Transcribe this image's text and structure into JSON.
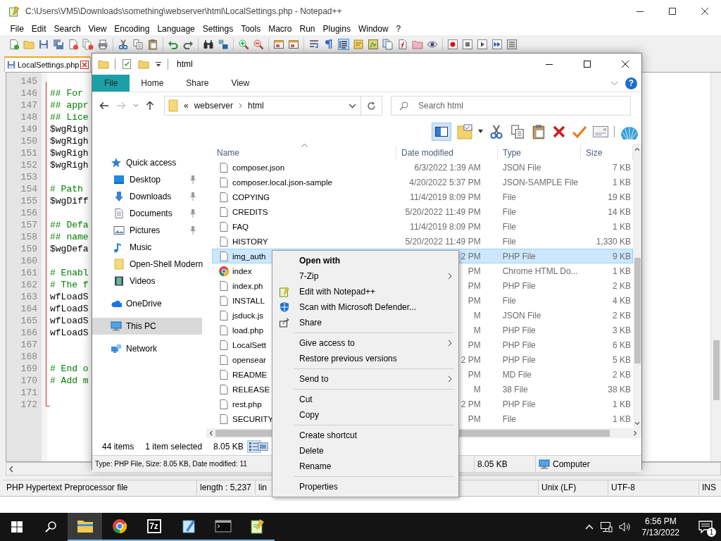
{
  "notepad": {
    "title": "C:\\Users\\VM5\\Downloads\\something\\webserver\\html\\LocalSettings.php - Notepad++",
    "menu": [
      "File",
      "Edit",
      "Search",
      "View",
      "Encoding",
      "Language",
      "Settings",
      "Tools",
      "Macro",
      "Run",
      "Plugins",
      "Window",
      "?"
    ],
    "tabs": [
      {
        "label": "LocalSettings.php",
        "selected": true
      }
    ],
    "lines": [
      {
        "number": "145"
      },
      {
        "number": "146",
        "kind": "comment",
        "text": "## For"
      },
      {
        "number": "147",
        "kind": "comment",
        "text": "## appr"
      },
      {
        "number": "148",
        "kind": "comment",
        "text": "## Lice"
      },
      {
        "number": "149",
        "kind": "code",
        "text": "$wgRigh"
      },
      {
        "number": "150",
        "kind": "code",
        "text": "$wgRigh"
      },
      {
        "number": "151",
        "kind": "code",
        "text": "$wgRigh"
      },
      {
        "number": "152",
        "kind": "code",
        "text": "$wgRigh"
      },
      {
        "number": "153"
      },
      {
        "number": "154",
        "kind": "comment",
        "text": "# Path"
      },
      {
        "number": "155",
        "kind": "code",
        "text": "$wgDiff"
      },
      {
        "number": "156"
      },
      {
        "number": "157",
        "kind": "comment",
        "text": "## Defa"
      },
      {
        "number": "158",
        "kind": "comment",
        "text": "## name"
      },
      {
        "number": "159",
        "kind": "code",
        "text": "$wgDefa"
      },
      {
        "number": "160"
      },
      {
        "number": "161",
        "kind": "comment",
        "text": "# Enabl"
      },
      {
        "number": "162",
        "kind": "comment",
        "text": "# The f"
      },
      {
        "number": "163",
        "kind": "code",
        "text": "wfLoadS"
      },
      {
        "number": "164",
        "kind": "code",
        "text": "wfLoadS"
      },
      {
        "number": "165",
        "kind": "code",
        "text": "wfLoadS"
      },
      {
        "number": "166",
        "kind": "code",
        "text": "wfLoadS"
      },
      {
        "number": "167"
      },
      {
        "number": "168"
      },
      {
        "number": "169",
        "kind": "comment",
        "text": "# End o"
      },
      {
        "number": "170",
        "kind": "comment",
        "text": "# Add m"
      },
      {
        "number": "171"
      },
      {
        "number": "172"
      }
    ],
    "status_bar": [
      "PHP Hypertext Preprocessor file",
      "length : 5,237",
      "lin",
      "Unix (LF)",
      "UTF-8",
      "INS"
    ]
  },
  "explorer": {
    "title": "html",
    "ribbon_tabs": [
      {
        "label": "File",
        "selected": true
      },
      {
        "label": "Home",
        "selected": false
      },
      {
        "label": "Share",
        "selected": false
      },
      {
        "label": "View",
        "selected": false
      }
    ],
    "help": "?",
    "address": {
      "overflow": "«",
      "crumbs": [
        "webserver",
        "html"
      ]
    },
    "search": {
      "placeholder": "Search html"
    },
    "navigation": [
      {
        "label": "Quick access",
        "selected": false,
        "children": [
          {
            "label": "Desktop",
            "selected": false,
            "pinned": true
          },
          {
            "label": "Downloads",
            "selected": false,
            "pinned": true
          },
          {
            "label": "Documents",
            "selected": false,
            "pinned": true
          },
          {
            "label": "Pictures",
            "selected": false,
            "pinned": true
          },
          {
            "label": "Music",
            "selected": false,
            "pinned": false
          },
          {
            "label": "Open-Shell Modern",
            "selected": false,
            "pinned": false
          },
          {
            "label": "Videos",
            "selected": false,
            "pinned": false
          }
        ]
      },
      {
        "label": "OneDrive",
        "selected": false
      },
      {
        "label": "This PC",
        "selected": true
      },
      {
        "label": "Network",
        "selected": false
      }
    ],
    "columns": [
      {
        "label": "Name",
        "sorted": true
      },
      {
        "label": "Date modified",
        "sorted": false
      },
      {
        "label": "Type",
        "sorted": false
      },
      {
        "label": "Size",
        "sorted": false
      }
    ],
    "files": [
      {
        "kind": "document",
        "name": "composer.json",
        "date": "6/3/2022 1:39 AM",
        "type": "JSON File",
        "size": "7 KB",
        "selected": false
      },
      {
        "kind": "document",
        "name": "composer.local.json-sample",
        "date": "4/20/2022 5:37 PM",
        "type": "JSON-SAMPLE File",
        "size": "1 KB",
        "selected": false
      },
      {
        "kind": "document",
        "name": "COPYING",
        "date": "11/4/2019 8:09 PM",
        "type": "File",
        "size": "19 KB",
        "selected": false
      },
      {
        "kind": "document",
        "name": "CREDITS",
        "date": "5/20/2022 11:49 PM",
        "type": "File",
        "size": "14 KB",
        "selected": false
      },
      {
        "kind": "document",
        "name": "FAQ",
        "date": "11/4/2019 8:09 PM",
        "type": "File",
        "size": "1 KB",
        "selected": false
      },
      {
        "kind": "document",
        "name": "HISTORY",
        "date": "5/20/2022 11:49 PM",
        "type": "File",
        "size": "1,330 KB",
        "selected": false
      },
      {
        "kind": "document",
        "name": "img_auth",
        "date": "2 PM",
        "type": "PHP File",
        "size": "9 KB",
        "selected": true
      },
      {
        "kind": "web-page",
        "name": "index",
        "date": "PM",
        "type": "Chrome HTML Do...",
        "size": "1 KB",
        "selected": false
      },
      {
        "kind": "document",
        "name": "index.ph",
        "date": "PM",
        "type": "PHP File",
        "size": "2 KB",
        "selected": false
      },
      {
        "kind": "document",
        "name": "INSTALL",
        "date": "PM",
        "type": "File",
        "size": "4 KB",
        "selected": false
      },
      {
        "kind": "document",
        "name": "jsduck.js",
        "date": "M",
        "type": "JSON File",
        "size": "2 KB",
        "selected": false
      },
      {
        "kind": "document",
        "name": "load.php",
        "date": "M",
        "type": "PHP File",
        "size": "3 KB",
        "selected": false
      },
      {
        "kind": "document",
        "name": "LocalSett",
        "date": "PM",
        "type": "PHP File",
        "size": "6 KB",
        "selected": false
      },
      {
        "kind": "document",
        "name": "opensear",
        "date": "2 PM",
        "type": "PHP File",
        "size": "5 KB",
        "selected": false
      },
      {
        "kind": "document",
        "name": "README",
        "date": "PM",
        "type": "MD File",
        "size": "2 KB",
        "selected": false
      },
      {
        "kind": "document",
        "name": "RELEASE",
        "date": "M",
        "type": "38 File",
        "size": "38 KB",
        "selected": false
      },
      {
        "kind": "document",
        "name": "rest.php",
        "date": "2 PM",
        "type": "PHP File",
        "size": "1 KB",
        "selected": false
      },
      {
        "kind": "document",
        "name": "SECURITY",
        "date": "PM",
        "type": "File",
        "size": "1 KB",
        "selected": false
      }
    ],
    "status": {
      "count": "44 items",
      "selection": "1 item selected",
      "size": "8.05 KB"
    },
    "view_buttons": [
      {
        "selected": true
      },
      {
        "selected": false
      }
    ],
    "details_bar": {
      "info": "Type: PHP File, Size: 8.05 KB, Date modified: 11",
      "size": "8.05 KB",
      "location": "Computer"
    }
  },
  "context_menu": {
    "items": [
      {
        "kind": "item",
        "label": "Open with",
        "default": true,
        "icon": false,
        "submenu": false
      },
      {
        "kind": "item",
        "label": "7-Zip",
        "default": false,
        "icon": false,
        "submenu": true
      },
      {
        "kind": "item",
        "label": "Edit with Notepad++",
        "default": false,
        "icon": true,
        "submenu": false
      },
      {
        "kind": "item",
        "label": "Scan with Microsoft Defender...",
        "default": false,
        "icon": true,
        "submenu": false
      },
      {
        "kind": "item",
        "label": "Share",
        "default": false,
        "icon": true,
        "submenu": false
      },
      {
        "kind": "separator"
      },
      {
        "kind": "item",
        "label": "Give access to",
        "default": false,
        "icon": false,
        "submenu": true
      },
      {
        "kind": "item",
        "label": "Restore previous versions",
        "default": false,
        "icon": false,
        "submenu": false
      },
      {
        "kind": "separator"
      },
      {
        "kind": "item",
        "label": "Send to",
        "default": false,
        "icon": false,
        "submenu": true
      },
      {
        "kind": "separator"
      },
      {
        "kind": "item",
        "label": "Cut",
        "default": false,
        "icon": false,
        "submenu": false
      },
      {
        "kind": "item",
        "label": "Copy",
        "default": false,
        "icon": false,
        "submenu": false
      },
      {
        "kind": "separator"
      },
      {
        "kind": "item",
        "label": "Create shortcut",
        "default": false,
        "icon": false,
        "submenu": false
      },
      {
        "kind": "item",
        "label": "Delete",
        "default": false,
        "icon": false,
        "submenu": false
      },
      {
        "kind": "item",
        "label": "Rename",
        "default": false,
        "icon": false,
        "submenu": false
      },
      {
        "kind": "separator"
      },
      {
        "kind": "item",
        "label": "Properties",
        "default": false,
        "icon": false,
        "submenu": false
      }
    ]
  },
  "taskbar": {
    "apps": [
      {
        "active": true,
        "running": true
      },
      {
        "active": false,
        "running": true
      },
      {
        "label": "7z",
        "active": false,
        "running": true
      },
      {
        "active": false,
        "running": true
      },
      {
        "active": false,
        "running": true
      },
      {
        "active": false,
        "running": true
      }
    ],
    "clock": {
      "time": "6:56 PM",
      "date": "7/13/2022"
    },
    "notifications": "1"
  }
}
